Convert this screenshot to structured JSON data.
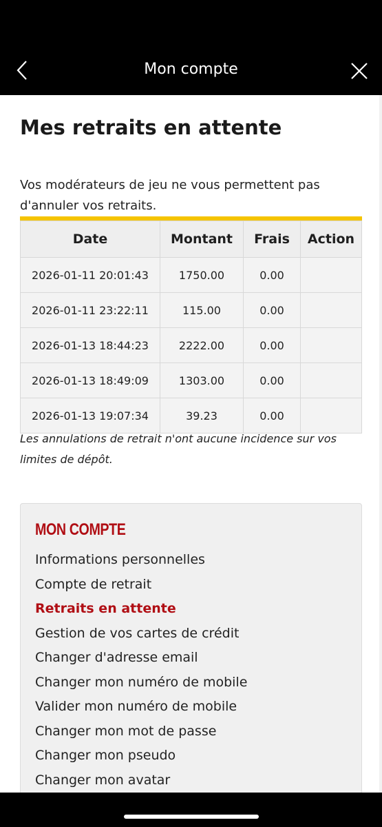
{
  "header": {
    "title": "Mon compte",
    "back_icon": "chevron-left-icon",
    "close_icon": "close-icon"
  },
  "page": {
    "title": "Mes retraits en attente",
    "intro": "Vos modérateurs de jeu ne vous permettent pas d'annuler vos retraits.",
    "note": "Les annulations de retrait n'ont aucune incidence sur vos limites de dépôt."
  },
  "table": {
    "headers": [
      "Date",
      "Montant",
      "Frais",
      "Action"
    ],
    "rows": [
      {
        "date": "2026-01-11 20:01:43",
        "amount": "1750.00",
        "fees": "0.00",
        "action": ""
      },
      {
        "date": "2026-01-11 23:22:11",
        "amount": "115.00",
        "fees": "0.00",
        "action": ""
      },
      {
        "date": "2026-01-13 18:44:23",
        "amount": "2222.00",
        "fees": "0.00",
        "action": ""
      },
      {
        "date": "2026-01-13 18:49:09",
        "amount": "1303.00",
        "fees": "0.00",
        "action": ""
      },
      {
        "date": "2026-01-13 19:07:34",
        "amount": "39.23",
        "fees": "0.00",
        "action": ""
      }
    ]
  },
  "account_menu": {
    "title": "MON COMPTE",
    "items": [
      {
        "label": "Informations personnelles",
        "active": false
      },
      {
        "label": "Compte de retrait",
        "active": false
      },
      {
        "label": "Retraits en attente",
        "active": true
      },
      {
        "label": "Gestion de vos cartes de crédit",
        "active": false
      },
      {
        "label": "Changer d'adresse email",
        "active": false
      },
      {
        "label": "Changer mon numéro de mobile",
        "active": false
      },
      {
        "label": "Valider mon numéro de mobile",
        "active": false
      },
      {
        "label": "Changer mon mot de passe",
        "active": false
      },
      {
        "label": "Changer mon pseudo",
        "active": false
      },
      {
        "label": "Changer mon avatar",
        "active": false
      }
    ]
  },
  "colors": {
    "accent_yellow": "#f5c400",
    "brand_red": "#b00e14",
    "bar_black": "#000000"
  }
}
